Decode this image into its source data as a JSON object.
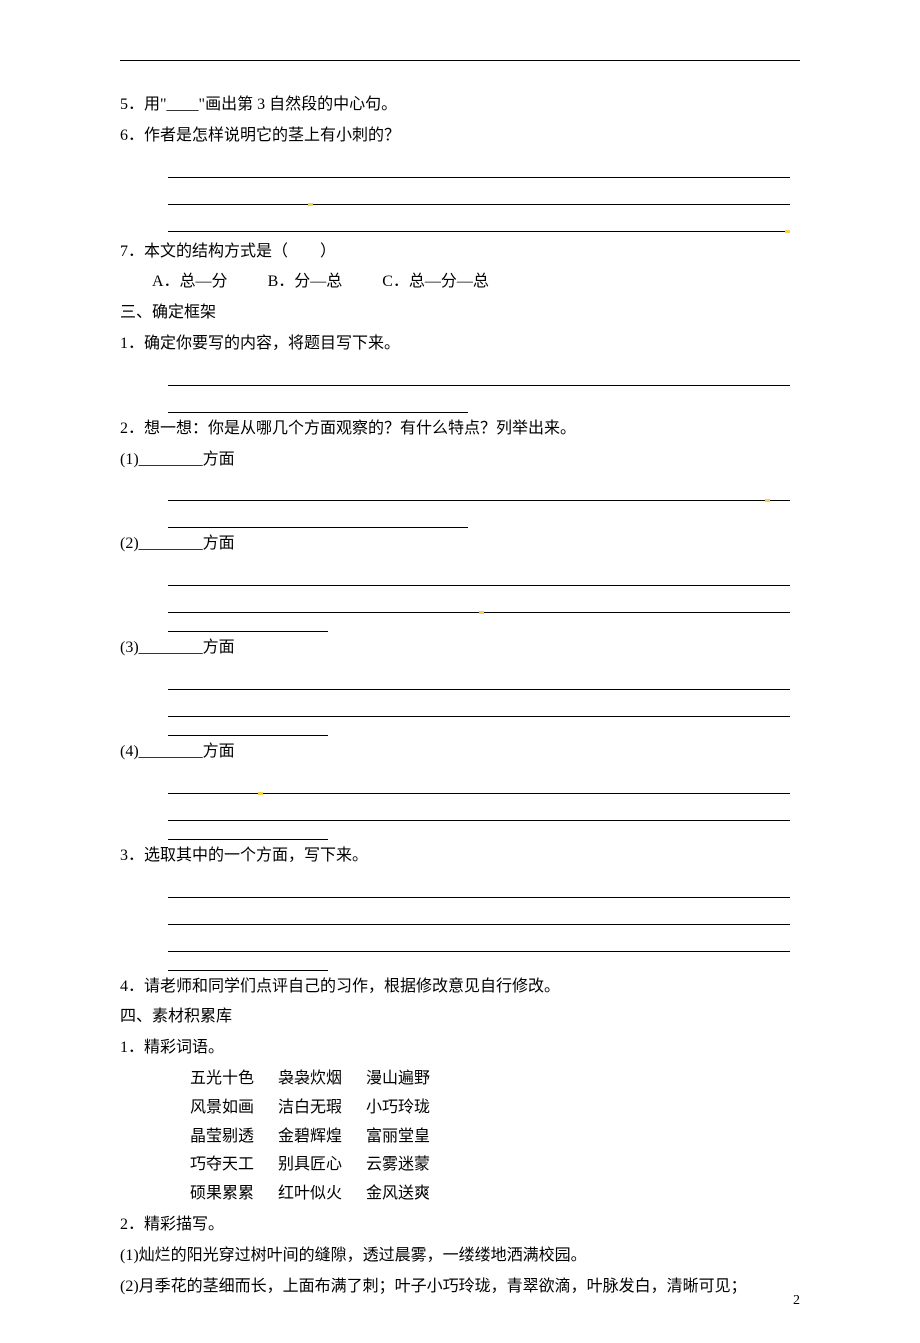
{
  "q5": "5．用\"____\"画出第 3 自然段的中心句。",
  "q6": "6．作者是怎样说明它的茎上有小刺的？",
  "q7": {
    "stem": "7．本文的结构方式是（　　）",
    "optA": "A．总—分",
    "optB": "B．分—总",
    "optC": "C．总—分—总"
  },
  "sec3": {
    "title": "三、确定框架",
    "i1": "1．确定你要写的内容，将题目写下来。",
    "i2": "2．想一想：你是从哪几个方面观察的？有什么特点？列举出来。",
    "blank_aspect": "________方面",
    "sub1": "(1)",
    "sub2": "(2)",
    "sub3": "(3)",
    "sub4": "(4)",
    "i3": "3．选取其中的一个方面，写下来。",
    "i4": "4．请老师和同学们点评自己的习作，根据修改意见自行修改。"
  },
  "sec4": {
    "title": "四、素材积累库",
    "i1": "1．精彩词语。",
    "row1": [
      "五光十色",
      "袅袅炊烟",
      "漫山遍野"
    ],
    "row2": [
      "风景如画",
      "洁白无瑕",
      "小巧玲珑"
    ],
    "row3": [
      "晶莹剔透",
      "金碧辉煌",
      "富丽堂皇"
    ],
    "row4": [
      "巧夺天工",
      "别具匠心",
      "云雾迷蒙"
    ],
    "row5": [
      "硕果累累",
      "红叶似火",
      "金风送爽"
    ],
    "i2": "2．精彩描写。",
    "d1": "(1)灿烂的阳光穿过树叶间的缝隙，透过晨雾，一缕缕地洒满校园。",
    "d2": "(2)月季花的茎细而长，上面布满了刺；叶子小巧玲珑，青翠欲滴，叶脉发白，清晰可见；"
  },
  "pageNum": "2"
}
